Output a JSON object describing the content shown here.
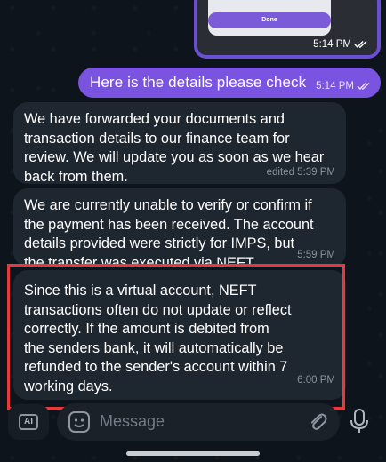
{
  "image_message": {
    "button_label": "Done",
    "time": "5:14 PM"
  },
  "outgoing_message": {
    "text": "Here is the details please check",
    "time": "5:14 PM"
  },
  "incoming_messages": [
    {
      "lines": [
        "We have forwarded your documents and",
        "transaction details to our finance team for",
        "review. We will update you as soon as we hear",
        "back from them."
      ],
      "time": "edited 5:39 PM"
    },
    {
      "lines": [
        "We are currently unable to verify or confirm if",
        "the payment has been received. The account",
        "details provided were strictly for IMPS, but",
        "the transfer was executed via NEFT."
      ],
      "time": "5:59 PM"
    },
    {
      "lines": [
        "Since this is a virtual account, NEFT",
        "transactions often do not update or reflect",
        "correctly. If the amount is debited from",
        "the senders bank, it will automatically be",
        "refunded to the sender's account within 7",
        "working days."
      ],
      "time": "6:00 PM"
    }
  ],
  "input_bar": {
    "ai_label": "AI",
    "placeholder": "Message",
    "icons": [
      "ai-icon",
      "sticker-icon",
      "paperclip-icon",
      "microphone-icon"
    ]
  },
  "colors": {
    "outgoing_bubble": "#7a54e0",
    "incoming_bubble": "#1e2630",
    "highlight": "#e8383a"
  }
}
